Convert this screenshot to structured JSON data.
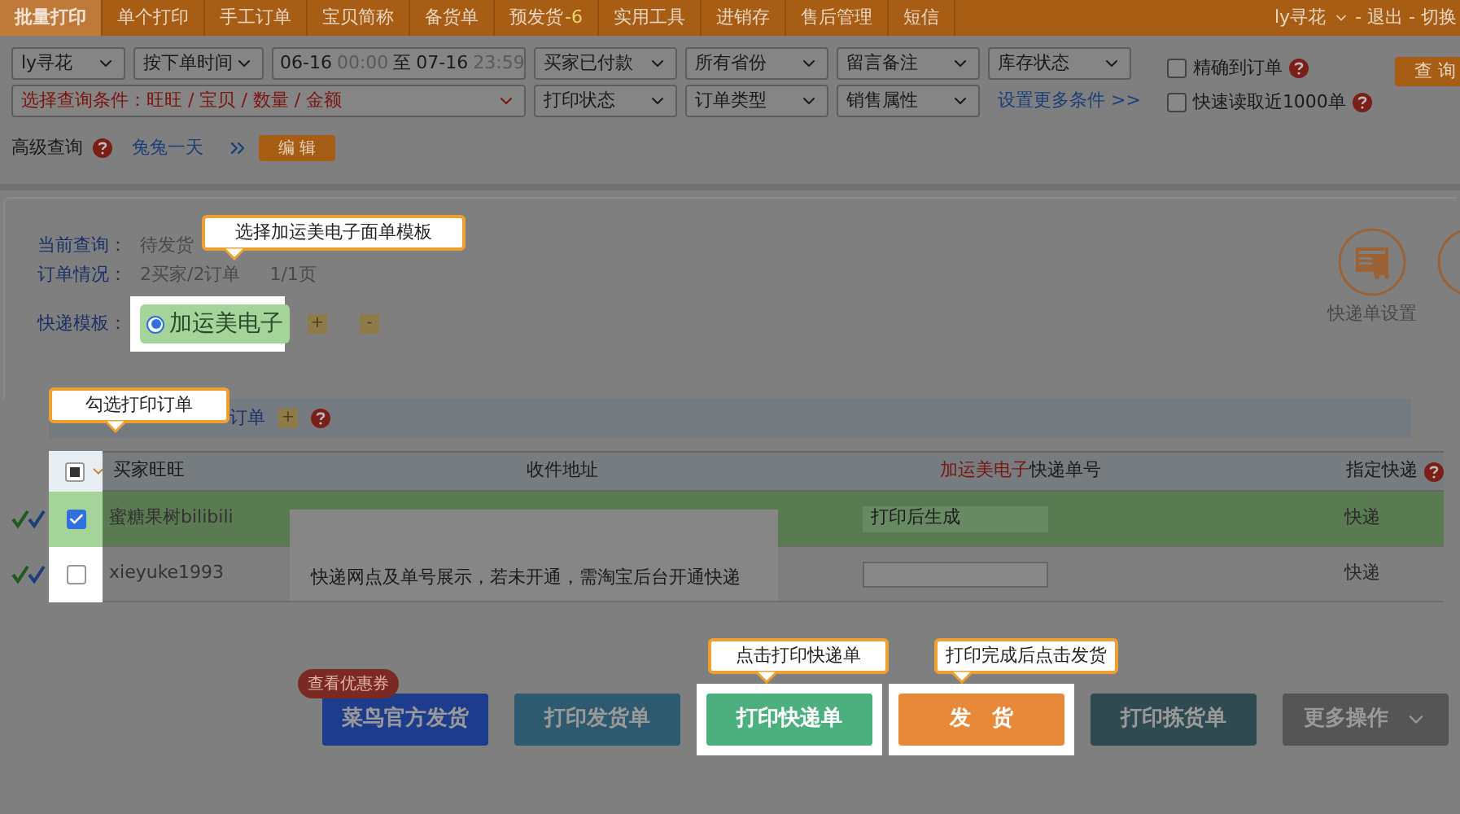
{
  "nav": {
    "tabs": [
      {
        "label": "批量打印",
        "selected": true
      },
      {
        "label": "单个打印",
        "selected": false
      },
      {
        "label": "手工订单",
        "selected": false
      },
      {
        "label": "宝贝简称",
        "selected": false
      },
      {
        "label": "备货单",
        "selected": false
      },
      {
        "label": "预发货",
        "count": "-6",
        "selected": false
      },
      {
        "label": "实用工具",
        "selected": false
      },
      {
        "label": "进销存",
        "selected": false
      },
      {
        "label": "售后管理",
        "selected": false
      },
      {
        "label": "短信",
        "selected": false
      }
    ],
    "user": "ly寻花",
    "links": "- 退出 - 切换"
  },
  "filters": {
    "shop": "ly寻花",
    "time_type": "按下单时间",
    "date_range": {
      "from_date": "06-16",
      "from_time": "00:00",
      "separator": "至",
      "to_date": "07-16",
      "to_time": "23:59"
    },
    "selects_row1": [
      "买家已付款",
      "所有省份",
      "留言备注",
      "库存状态"
    ],
    "condition": "选择查询条件：旺旺 / 宝贝 / 数量 / 金额",
    "selects_row2": [
      "打印状态",
      "订单类型",
      "销售属性"
    ],
    "more_link": "设置更多条件 >>",
    "options": [
      {
        "label": "精确到订单",
        "checked": false
      },
      {
        "label": "快速读取近1000单",
        "checked": false
      }
    ],
    "search_button": "查 询"
  },
  "advanced": {
    "label": "高级查询",
    "preset": "兔兔一天",
    "edit_button": "编 辑"
  },
  "summary": {
    "query_label": "当前查询：",
    "query_value": "待发货",
    "orders_label": "订单情况：",
    "orders_value": "2买家/2订单",
    "pages": "1/1页",
    "template_label": "快递模板：",
    "templates": [
      {
        "label": "加运美电子",
        "selected": true
      }
    ],
    "add": "+",
    "remove": "-"
  },
  "tools": [
    {
      "label": "快递单设置"
    }
  ],
  "section": {
    "title": "订单",
    "add": "+"
  },
  "table": {
    "header_partial": true,
    "columns": [
      {
        "label": "买家旺旺"
      },
      {
        "label": "收件地址"
      },
      {
        "highlight": "加运美电子",
        "label": "快递单号"
      },
      {
        "label": "指定快递",
        "help": true
      }
    ],
    "rows": [
      {
        "checked": true,
        "buyer": "蜜糖果树bilibili",
        "tracking": "打印后生成",
        "carrier": "快递"
      },
      {
        "checked": false,
        "buyer": "xieyuke1993",
        "tracking": "",
        "carrier": "快递"
      }
    ]
  },
  "tooltip": "快递网点及单号展示，若未开通，需淘宝后台开通快递",
  "actions": [
    {
      "label": "菜鸟官方发货",
      "color": "#1e3c8c",
      "badge": "查看优惠券",
      "highlighted": false
    },
    {
      "label": "打印发货单",
      "color": "#2d5a6e",
      "highlighted": false
    },
    {
      "label": "打印快递单",
      "color": "#4caf7e",
      "highlighted": true
    },
    {
      "label": "发　货",
      "color": "#e8893a",
      "highlighted": true
    },
    {
      "label": "打印拣货单",
      "color": "#2f4a50",
      "highlighted": false
    },
    {
      "label": "更多操作",
      "color": "#555555",
      "menu": true,
      "highlighted": false
    }
  ],
  "callouts": [
    {
      "text": "选择加运美电子面单模板"
    },
    {
      "text": "勾选打印订单"
    },
    {
      "text": "点击打印快递单"
    },
    {
      "text": "打印完成后点击发货"
    }
  ]
}
